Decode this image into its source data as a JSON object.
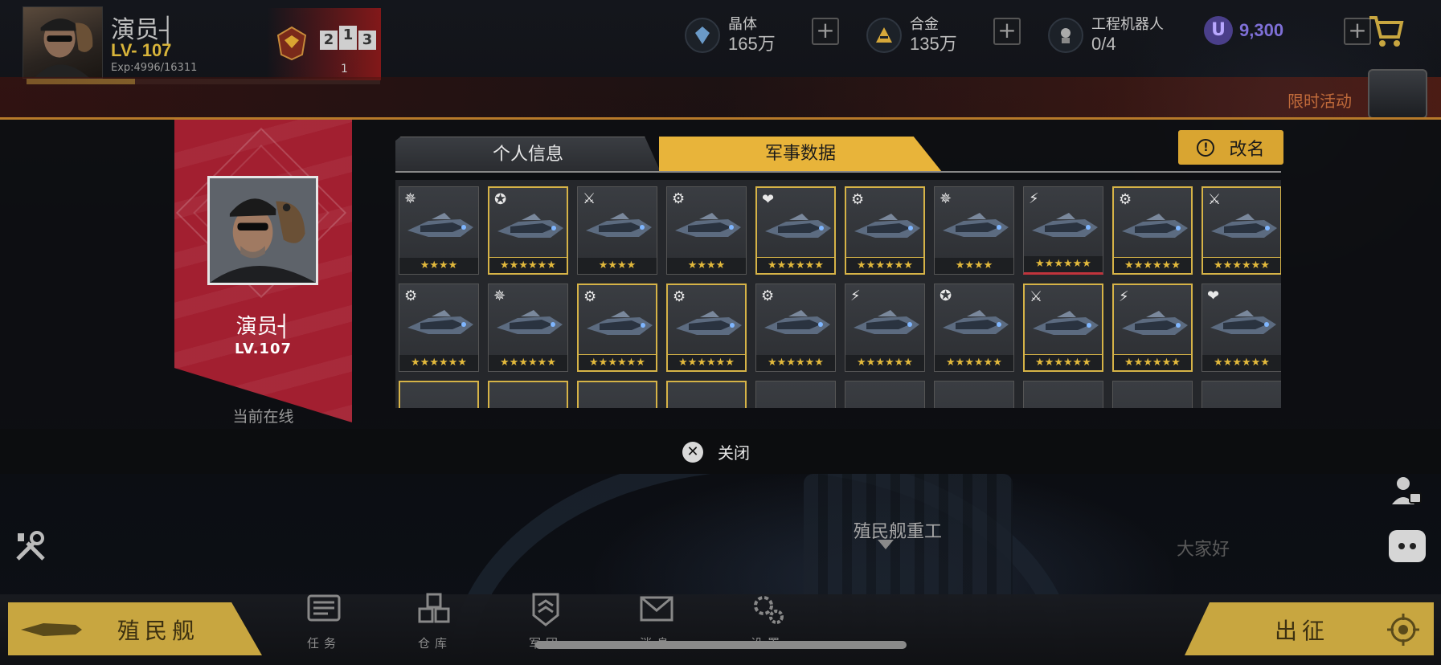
{
  "player": {
    "name": "演员┤",
    "level": "LV- 107",
    "exp": "Exp:4996/16311",
    "exp_fraction": 0.306,
    "rank_podium": [
      "2",
      "1",
      "3"
    ],
    "rank": "1"
  },
  "resources": [
    {
      "label": "晶体",
      "value": "165万",
      "icon": "crystal-icon"
    },
    {
      "label": "合金",
      "value": "135万",
      "icon": "alloy-icon"
    },
    {
      "label": "工程机器人",
      "value": "0/4",
      "icon": "robot-icon"
    }
  ],
  "credits": {
    "symbol": "U",
    "value": "9,300"
  },
  "event": {
    "label": "限时活动"
  },
  "profile": {
    "name": "演员┤",
    "level": "LV.107",
    "status": "当前在线"
  },
  "tabs": {
    "personal": "个人信息",
    "military": "军事数据"
  },
  "rename_label": "改名",
  "ships": [
    {
      "cls": "✵",
      "stars": "★★★★",
      "gold": false
    },
    {
      "cls": "✪",
      "stars": "★★★★★★",
      "gold": true
    },
    {
      "cls": "⚔",
      "stars": "★★★★",
      "gold": false
    },
    {
      "cls": "⚙",
      "stars": "★★★★",
      "gold": false
    },
    {
      "cls": "❤",
      "stars": "★★★★★★",
      "gold": true
    },
    {
      "cls": "⚙",
      "stars": "★★★★★★",
      "gold": true
    },
    {
      "cls": "✵",
      "stars": "★★★★",
      "gold": false
    },
    {
      "cls": "⚡",
      "stars": "★★★★★★",
      "gold": false,
      "red": true
    },
    {
      "cls": "⚙",
      "stars": "★★★★★★",
      "gold": true
    },
    {
      "cls": "⚔",
      "stars": "★★★★★★",
      "gold": true
    },
    {
      "cls": "⚙",
      "stars": "★★★★★★",
      "gold": false
    },
    {
      "cls": "✵",
      "stars": "★★★★★★",
      "gold": false
    },
    {
      "cls": "⚙",
      "stars": "★★★★★★",
      "gold": true
    },
    {
      "cls": "⚙",
      "stars": "★★★★★★",
      "gold": true
    },
    {
      "cls": "⚙",
      "stars": "★★★★★★",
      "gold": false
    },
    {
      "cls": "⚡",
      "stars": "★★★★★★",
      "gold": false
    },
    {
      "cls": "✪",
      "stars": "★★★★★★",
      "gold": false
    },
    {
      "cls": "⚔",
      "stars": "★★★★★★",
      "gold": true
    },
    {
      "cls": "⚡",
      "stars": "★★★★★★",
      "gold": true
    },
    {
      "cls": "❤",
      "stars": "★★★★★★",
      "gold": false
    }
  ],
  "close_label": "关闭",
  "location_label": "殖民舰重工",
  "chat_text": "大家好",
  "colony_label": "殖民舰",
  "deploy_label": "出征",
  "nav": [
    {
      "label": "任务",
      "icon": "task-icon"
    },
    {
      "label": "仓库",
      "icon": "warehouse-icon"
    },
    {
      "label": "军团",
      "icon": "legion-icon"
    },
    {
      "label": "消息",
      "icon": "message-icon"
    },
    {
      "label": "设置",
      "icon": "settings-icon"
    }
  ],
  "colors": {
    "gold": "#d9a531",
    "banner_red": "#a21f30",
    "credit_purple": "#7e6fd6"
  }
}
